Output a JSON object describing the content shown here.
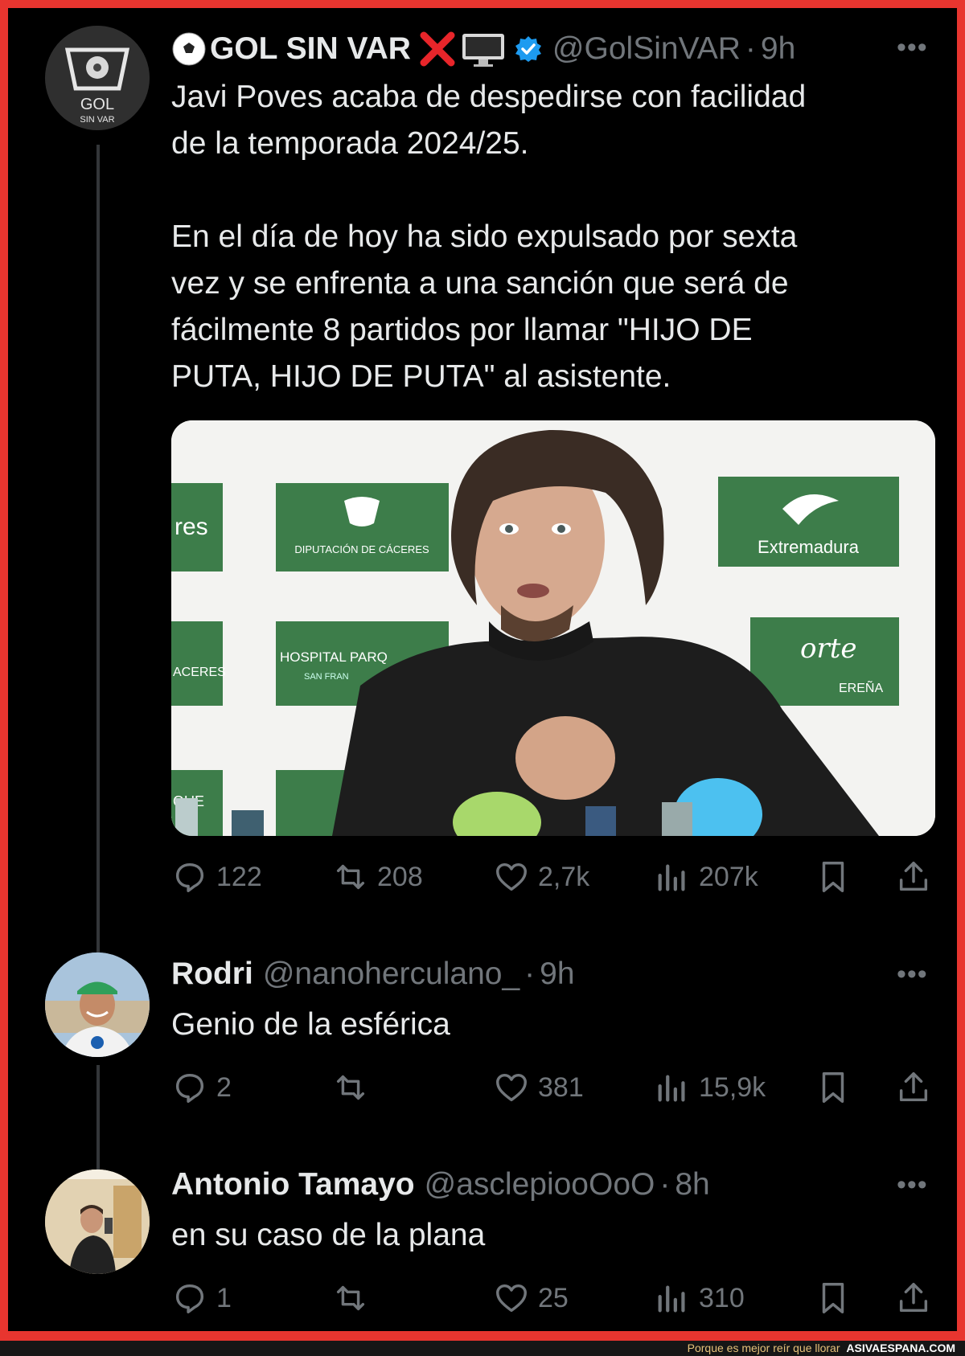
{
  "colors": {
    "accent": "#1d9bf0",
    "border": "#e8352f",
    "text": "#e7e9ea",
    "muted": "#71767b"
  },
  "tweets": [
    {
      "name_prefix_icon": "soccer-ball-icon",
      "name": "GOL SIN VAR",
      "name_suffix_icons": [
        "red-x-icon",
        "monitor-icon",
        "verified-badge-icon"
      ],
      "handle": "@GolSinVAR",
      "time": "9h",
      "avatar_text": "GOL",
      "avatar_subtext": "SIN VAR",
      "text": "Javi Poves acaba de despedirse con facilidad\nde la temporada 2024/25.\n\nEn el día de hoy ha sido expulsado por sexta\nvez y se enfrenta a una sanción que será de\nfácilmente 8 partidos por llamar \"HIJO DE\nPUTA, HIJO DE PUTA\" al asistente.",
      "media": {
        "signs": [
          "res",
          "DIPUTACIÓN DE CÁCERES",
          "Extremadura",
          "HOSPITAL PARQ",
          "SAN FRAN",
          "ACERES",
          "orte",
          "EREÑA",
          "QUE"
        ]
      },
      "stats": {
        "replies": "122",
        "retweets": "208",
        "likes": "2,7k",
        "views": "207k"
      }
    },
    {
      "name": "Rodri",
      "handle": "@nanoherculano_",
      "time": "9h",
      "text": "Genio de la esférica",
      "stats": {
        "replies": "2",
        "retweets": "",
        "likes": "381",
        "views": "15,9k"
      }
    },
    {
      "name": "Antonio Tamayo",
      "handle": "@asclepiooOoO",
      "time": "8h",
      "text": "en su caso de la plana",
      "stats": {
        "replies": "1",
        "retweets": "",
        "likes": "25",
        "views": "310"
      }
    }
  ],
  "more_label": "•••",
  "footer": {
    "tagline": "Porque es mejor reír que llorar",
    "site": "ASIVAESPANA.COM"
  }
}
